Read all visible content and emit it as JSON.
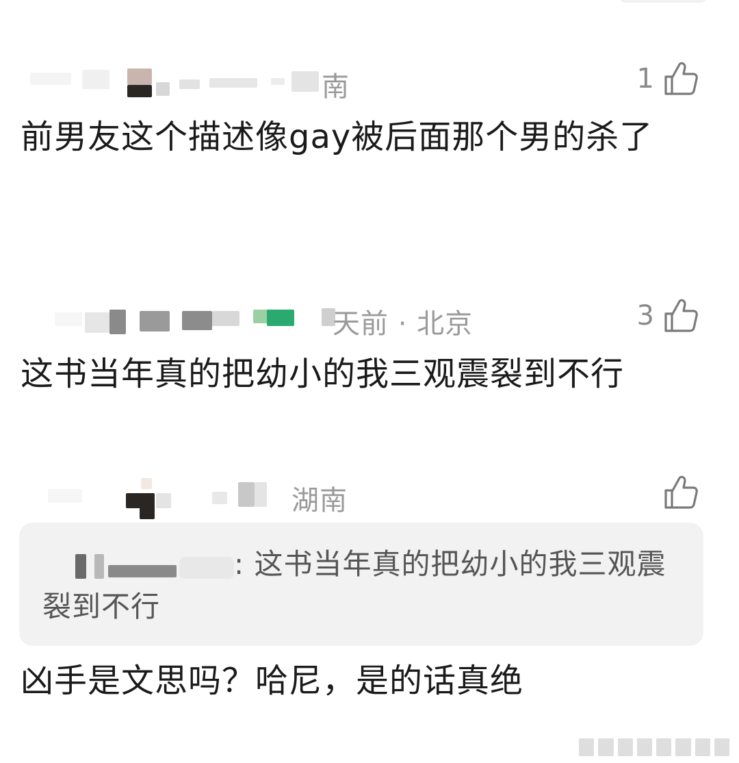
{
  "comments": [
    {
      "location": "南",
      "likes": "1",
      "text": "前男友这个描述像gay被后面那个男的杀了"
    },
    {
      "meta": "天前 · 北京",
      "likes": "3",
      "text": "这书当年真的把幼小的我三观震裂到不行"
    },
    {
      "location": "湖南",
      "likes": "",
      "quote": ": 这书当年真的把幼小的我三观震裂到不行",
      "text": "凶手是文思吗？哈尼，是的话真绝"
    }
  ],
  "colors": {
    "meta_gray": "#9a9a9a",
    "quote_bg": "#f2f2f2",
    "text": "#1a1a1a",
    "green_badge": "#2aaa6e"
  },
  "icons": {
    "like": "thumbs-up-icon"
  }
}
